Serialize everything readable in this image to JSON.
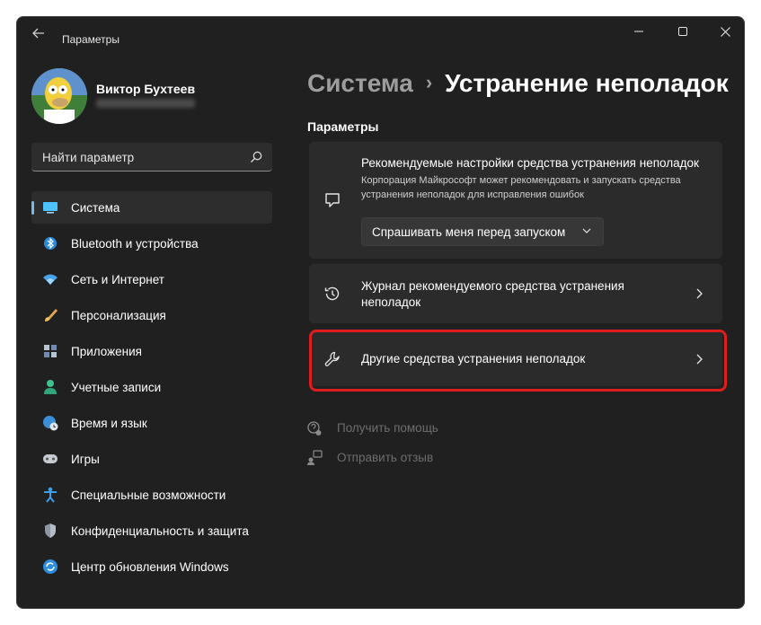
{
  "window": {
    "title": "Параметры"
  },
  "profile": {
    "name": "Виктор Бухтеев"
  },
  "search": {
    "placeholder": "Найти параметр"
  },
  "sidebar": {
    "items": [
      {
        "label": "Система",
        "icon": "display-icon",
        "active": true
      },
      {
        "label": "Bluetooth и устройства",
        "icon": "bluetooth-icon"
      },
      {
        "label": "Сеть и Интернет",
        "icon": "wifi-icon"
      },
      {
        "label": "Персонализация",
        "icon": "brush-icon"
      },
      {
        "label": "Приложения",
        "icon": "apps-icon"
      },
      {
        "label": "Учетные записи",
        "icon": "person-icon"
      },
      {
        "label": "Время и язык",
        "icon": "globe-clock-icon"
      },
      {
        "label": "Игры",
        "icon": "gamepad-icon"
      },
      {
        "label": "Специальные возможности",
        "icon": "accessibility-icon"
      },
      {
        "label": "Конфиденциальность и защита",
        "icon": "shield-icon"
      },
      {
        "label": "Центр обновления Windows",
        "icon": "update-icon"
      }
    ]
  },
  "main": {
    "breadcrumb": {
      "parent": "Система",
      "separator": "›",
      "current": "Устранение неполадок"
    },
    "section_title": "Параметры",
    "cards": {
      "recommended": {
        "title": "Рекомендуемые настройки средства устранения неполадок",
        "description": "Корпорация Майкрософт может рекомендовать и запускать средства устранения неполадок для исправления ошибок",
        "dropdown_value": "Спрашивать меня перед запуском"
      },
      "history": {
        "title": "Журнал рекомендуемого средства устранения неполадок"
      },
      "other": {
        "title": "Другие средства устранения неполадок"
      }
    },
    "links": {
      "help": "Получить помощь",
      "feedback": "Отправить отзыв"
    }
  },
  "colors": {
    "window_bg": "#202020",
    "card_bg": "#2b2b2b",
    "accent": "#76b9ed",
    "highlight": "#e01d1d"
  }
}
